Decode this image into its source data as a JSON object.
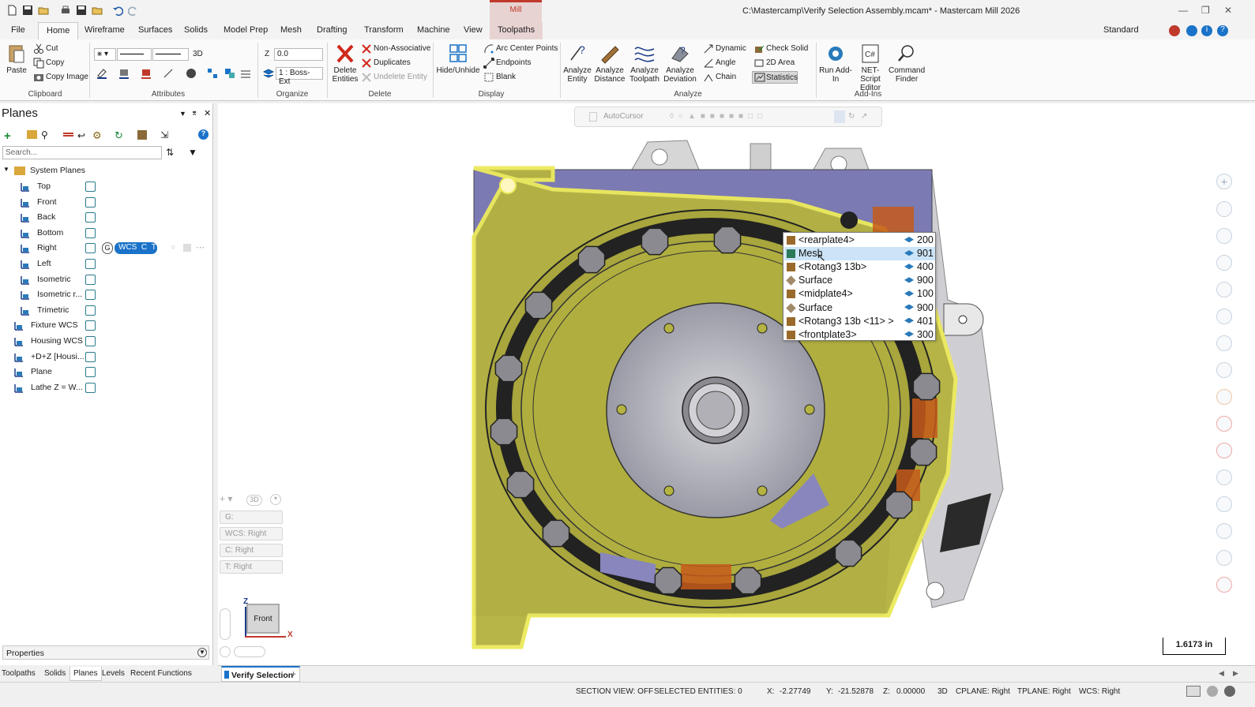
{
  "window": {
    "title": "C:\\Mastercamp\\Verify Selection Assembly.mcam* - Mastercam Mill 2026",
    "context_tab": "Mill",
    "workspace": "Standard"
  },
  "ribbon_tabs": [
    "File",
    "Home",
    "Wireframe",
    "Surfaces",
    "Solids",
    "Model Prep",
    "Mesh",
    "Drafting",
    "Transform",
    "Machine",
    "View",
    "Toolpaths"
  ],
  "ribbon": {
    "clipboard": {
      "label": "Clipboard",
      "paste": "Paste",
      "cut": "Cut",
      "copy": "Copy",
      "copy_image": "Copy Image"
    },
    "attributes": {
      "label": "Attributes",
      "point_style": "3D"
    },
    "organize": {
      "label": "Organize",
      "z_label": "Z",
      "z_value": "0.0",
      "level_value": "1 : Boss-Ext"
    },
    "delete": {
      "label": "Delete",
      "delete_entities": "Delete Entities",
      "non_associative": "Non-Associative",
      "duplicates": "Duplicates",
      "undelete": "Undelete Entity"
    },
    "display": {
      "label": "Display",
      "hide_unhide": "Hide/Unhide",
      "arc_center": "Arc Center Points",
      "endpoints": "Endpoints",
      "blank": "Blank"
    },
    "analyze": {
      "label": "Analyze",
      "analyze_entity": "Analyze Entity",
      "analyze_distance": "Analyze Distance",
      "analyze_toolpath": "Analyze Toolpath",
      "analyze_deviation": "Analyze Deviation",
      "dynamic": "Dynamic",
      "angle": "Angle",
      "chain": "Chain",
      "check_solid": "Check Solid",
      "area_2d": "2D Area",
      "statistics": "Statistics"
    },
    "addins": {
      "label": "Add-Ins",
      "run_addin": "Run Add-In",
      "net_script": "NET-Script Editor",
      "command_finder": "Command Finder"
    }
  },
  "planes_panel": {
    "title": "Planes",
    "search_placeholder": "Search...",
    "root": "System Planes",
    "items": [
      {
        "label": "Top"
      },
      {
        "label": "Front"
      },
      {
        "label": "Back"
      },
      {
        "label": "Bottom"
      },
      {
        "label": "Right"
      },
      {
        "label": "Left"
      },
      {
        "label": "Isometric"
      },
      {
        "label": "Isometric r..."
      },
      {
        "label": "Trimetric"
      },
      {
        "label": "Fixture WCS"
      },
      {
        "label": "Housing WCS"
      },
      {
        "label": "+D+Z [Housi..."
      },
      {
        "label": "Plane"
      },
      {
        "label": "Lathe Z = W..."
      }
    ],
    "right_badge": {
      "g": "G",
      "wcs": "WCS",
      "c": "C",
      "t": "T"
    },
    "properties": "Properties"
  },
  "bottom_tabs": [
    "Toolpaths",
    "Solids",
    "Planes",
    "Levels",
    "Recent Functions"
  ],
  "viewport": {
    "autocursor": "AutoCursor",
    "view_mode": "3D",
    "gview": "G:",
    "wcs": "WCS:",
    "wcs_value": "Right",
    "cplane": "C:",
    "cplane_value": "Right",
    "tplane": "T:",
    "tplane_value": "Right",
    "view_label": "Front",
    "axis_z": "Z",
    "axis_x": "X",
    "scale": "1.6173 in"
  },
  "selection_popup": [
    {
      "name": "<rearplate4>",
      "level": "200",
      "kind": "solid"
    },
    {
      "name": "Mesh",
      "level": "901",
      "kind": "mesh"
    },
    {
      "name": "<Rotang3 13b>",
      "level": "400",
      "kind": "solid"
    },
    {
      "name": "Surface",
      "level": "900",
      "kind": "surface"
    },
    {
      "name": "<midplate4>",
      "level": "100",
      "kind": "solid"
    },
    {
      "name": "Surface",
      "level": "900",
      "kind": "surface"
    },
    {
      "name": "<Rotang3 13b <11> >",
      "level": "401",
      "kind": "solid"
    },
    {
      "name": "<frontplate3>",
      "level": "300",
      "kind": "solid"
    }
  ],
  "doc_tab": "Verify Selection",
  "status": {
    "section_view": "SECTION VIEW: OFF",
    "selected": "SELECTED ENTITIES: 0",
    "x_label": "X:",
    "x": "-2.27749",
    "y_label": "Y:",
    "y": "-21.52878",
    "z_label": "Z:",
    "z": "0.00000",
    "mode": "3D",
    "cplane": "CPLANE: Right",
    "tplane": "TPLANE: Right",
    "wcs": "WCS: Right"
  },
  "colors": {
    "accent": "#1a73c8",
    "part_yellow": "#b5b341",
    "part_purple": "#7c7ab3",
    "highlight_row": "#cce4f7",
    "mill_tab": "#c0392b"
  }
}
